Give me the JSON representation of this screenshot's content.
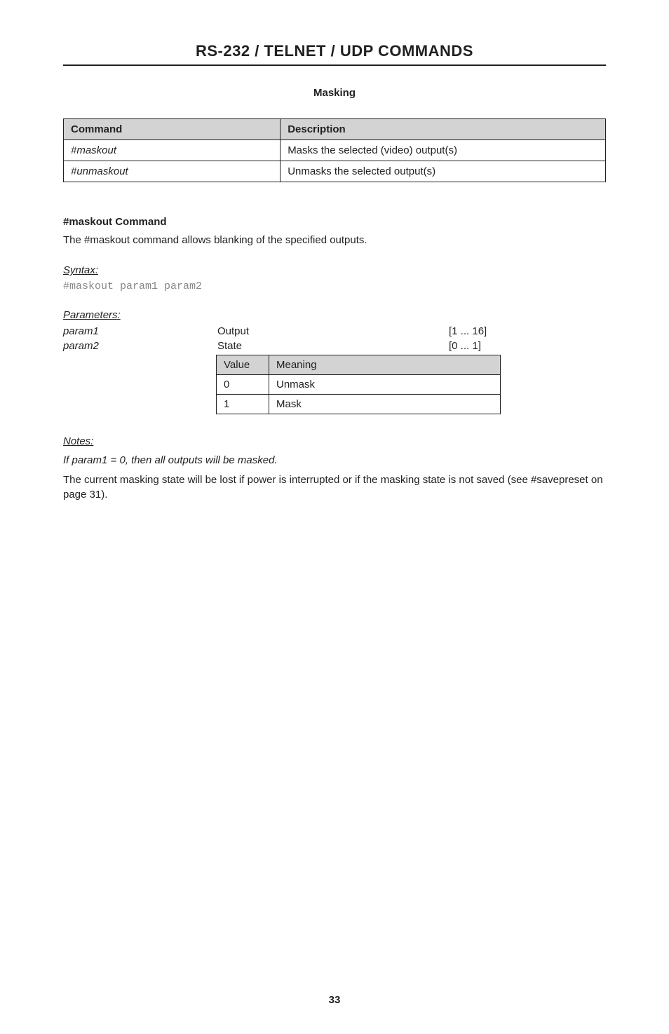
{
  "page_title": "RS-232 / TELNET / UDP COMMANDS",
  "subheading": "Masking",
  "cmd_table": {
    "headers": [
      "Command",
      "Description"
    ],
    "rows": [
      {
        "cmd": "#maskout",
        "desc": "Masks the selected (video) output(s)"
      },
      {
        "cmd": "#unmaskout",
        "desc": "Unmasks the selected output(s)"
      }
    ]
  },
  "maskout_heading": "#maskout Command",
  "maskout_desc": "The #maskout command allows blanking of the specified outputs.",
  "syntax_label": "Syntax",
  "syntax_colon": ":",
  "syntax_code": "#maskout param1 param2",
  "parameters_label": "Parameters",
  "parameters_colon": ":",
  "params": [
    {
      "name": "param1",
      "label": "Output",
      "range": "[1 ... 16]"
    },
    {
      "name": "param2",
      "label": "State",
      "range": "[0 ... 1]"
    }
  ],
  "value_table": {
    "headers": [
      "Value",
      "Meaning"
    ],
    "rows": [
      {
        "value": "0",
        "meaning": "Unmask"
      },
      {
        "value": "1",
        "meaning": "Mask"
      }
    ]
  },
  "notes_label": "Notes:",
  "notes_line": "If param1 = 0, then all outputs will be masked.",
  "notes_para": "The current masking state will be lost if power is interrupted or if the masking state is not saved (see #savepreset on page 31).",
  "page_number": "33"
}
